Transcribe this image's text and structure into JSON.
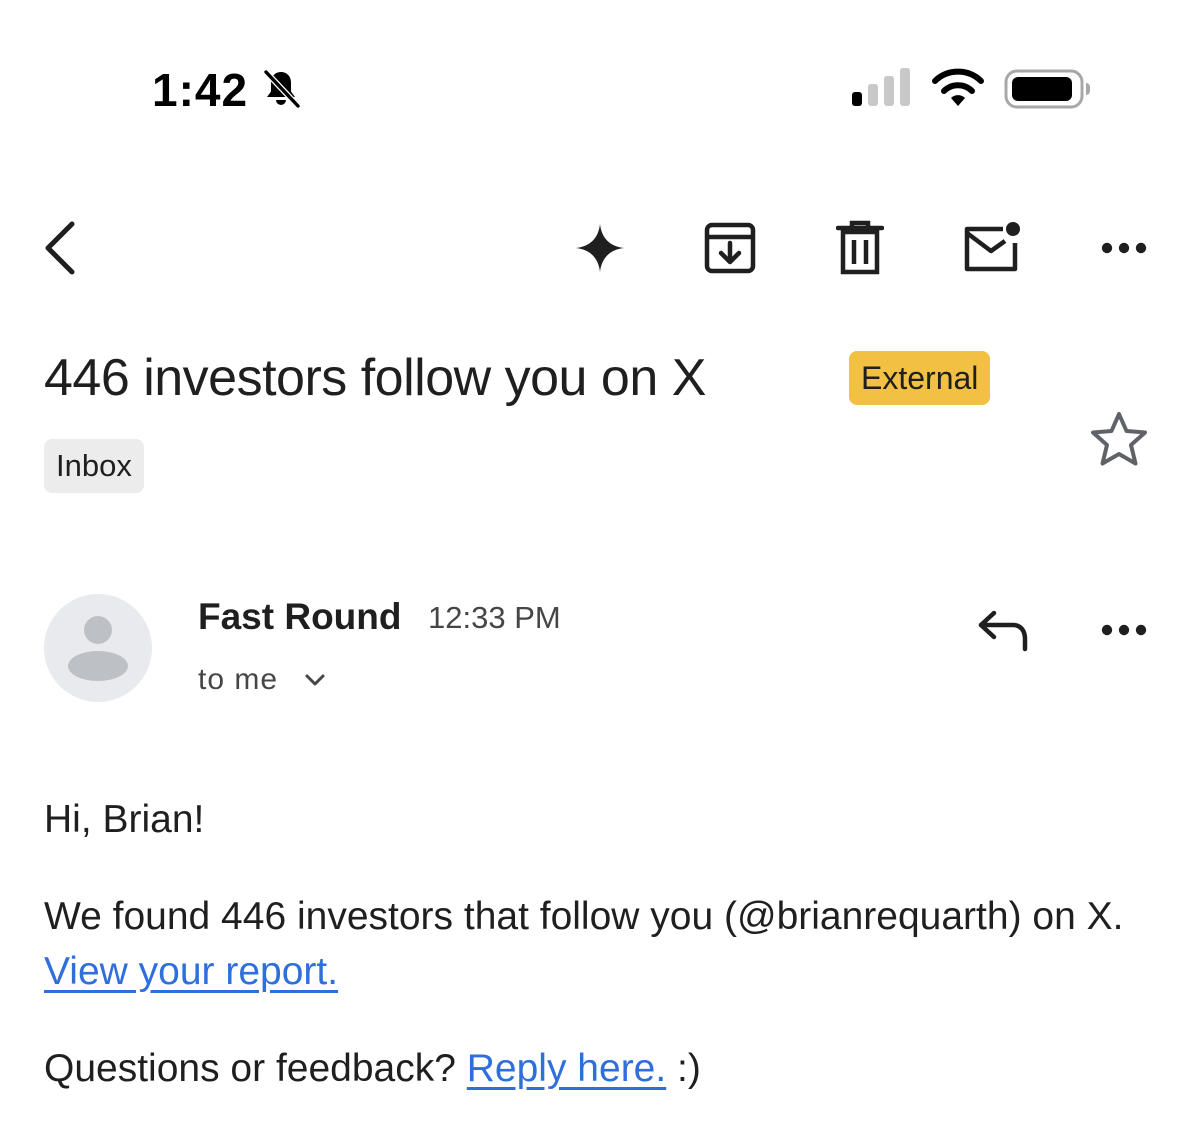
{
  "status_bar": {
    "time": "1:42",
    "icons": [
      "bell-off-icon",
      "cellular-signal-icon",
      "wifi-icon",
      "battery-icon"
    ]
  },
  "toolbar": {
    "icons": [
      "back-arrow-icon",
      "gemini-sparkle-icon",
      "archive-icon",
      "delete-icon",
      "mark-unread-icon",
      "more-vert-icon"
    ]
  },
  "email": {
    "subject": "446 investors follow you on X",
    "external_label": "External",
    "label_chip": "Inbox",
    "sender": "Fast Round",
    "time": "12:33 PM",
    "recipients": "to me",
    "greeting": "Hi, Brian!",
    "paragraph_1_text": "We found 446 investors that follow you (@brianrequarth) on X. ",
    "paragraph_1_link": "View your report.",
    "paragraph_2_text": "Questions or feedback? ",
    "paragraph_2_link": "Reply here.",
    "paragraph_2_suffix": " :)"
  },
  "colors": {
    "external_badge": "#f2c143",
    "link": "#2f6fdc",
    "chip_bg": "#ececec",
    "avatar_bg": "#e8eaed"
  }
}
